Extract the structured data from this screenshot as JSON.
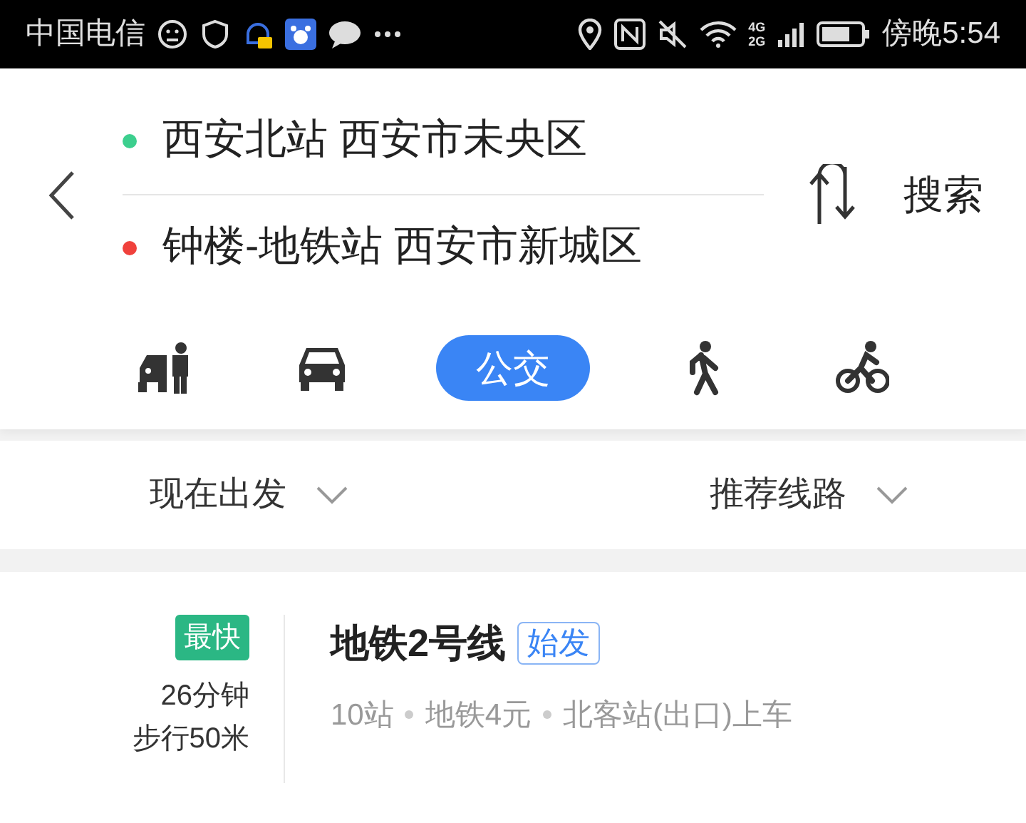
{
  "status_bar": {
    "carrier": "中国电信",
    "network": [
      "4G",
      "2G"
    ],
    "time": "傍晚5:54"
  },
  "route": {
    "points": [
      {
        "name": "西安北站 西安市未央区",
        "color": "#3ccf8e"
      },
      {
        "name": "钟楼-地铁站 西安市新城区",
        "color": "#f0413c"
      }
    ],
    "search_button": "搜索"
  },
  "modes": [
    {
      "kind": "taxi",
      "selected": false
    },
    {
      "kind": "car",
      "selected": false
    },
    {
      "kind": "bus",
      "label": "公交",
      "selected": true
    },
    {
      "kind": "walk",
      "selected": false
    },
    {
      "kind": "bike",
      "selected": false
    }
  ],
  "filters": [
    {
      "label": "现在出发"
    },
    {
      "label": "推荐线路"
    }
  ],
  "results": [
    {
      "badge": "最快",
      "duration": "26分钟",
      "walk": "步行50米",
      "line": "地铁2号线",
      "tag": "始发",
      "details": [
        "10站",
        "地铁4元",
        "北客站(出口)上车"
      ]
    }
  ]
}
